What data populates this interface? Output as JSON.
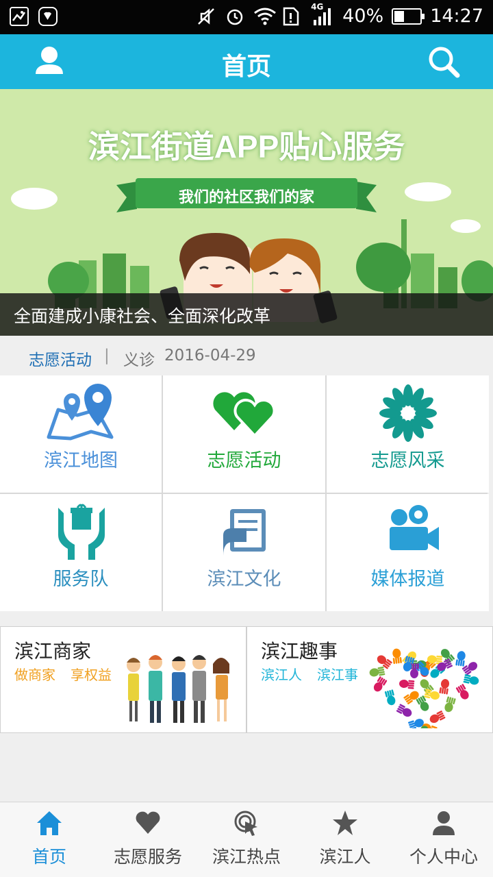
{
  "status_bar": {
    "battery": "40%",
    "battery_level": 0.4,
    "network": "4G",
    "time": "14:27",
    "icons": [
      "image-icon",
      "huawei-icon",
      "mute-icon",
      "alarm-icon",
      "wifi-icon",
      "sim-alert-icon",
      "signal-icon",
      "battery-icon"
    ]
  },
  "header": {
    "title": "首页",
    "left_icon": "user-icon",
    "right_icon": "search-icon",
    "color": "#1cb5dd"
  },
  "banner": {
    "headline": "滨江街道APP贴心服务",
    "ribbon": "我们的社区我们的家",
    "caption": "全面建成小康社会、全面深化改革"
  },
  "ticker": {
    "tag": "志愿活动",
    "separator": "|",
    "title": "义诊",
    "date": "2016-04-29"
  },
  "grid": [
    {
      "label": "滨江地图",
      "icon": "map-pin-icon",
      "color": "#4a90d9"
    },
    {
      "label": "志愿活动",
      "icon": "hearts-icon",
      "color": "#21a83a"
    },
    {
      "label": "志愿风采",
      "icon": "flower-icon",
      "color": "#139a8f"
    },
    {
      "label": "服务队",
      "icon": "gift-hands-icon",
      "color": "#2b8fbf"
    },
    {
      "label": "滨江文化",
      "icon": "book-icon",
      "color": "#5b8db8"
    },
    {
      "label": "媒体报道",
      "icon": "video-camera-icon",
      "color": "#2a9fd6"
    }
  ],
  "promos": [
    {
      "title": "滨江商家",
      "subs": [
        "做商家",
        "享权益"
      ],
      "sub_color": "#f0a020"
    },
    {
      "title": "滨江趣事",
      "subs": [
        "滨江人",
        "滨江事"
      ],
      "sub_color": "#22b5d8"
    }
  ],
  "bottom_nav": [
    {
      "label": "首页",
      "icon": "home-icon",
      "active": true
    },
    {
      "label": "志愿服务",
      "icon": "heart-icon",
      "active": false
    },
    {
      "label": "滨江热点",
      "icon": "hotspot-icon",
      "active": false
    },
    {
      "label": "滨江人",
      "icon": "star-icon",
      "active": false
    },
    {
      "label": "个人中心",
      "icon": "person-icon",
      "active": false
    }
  ]
}
